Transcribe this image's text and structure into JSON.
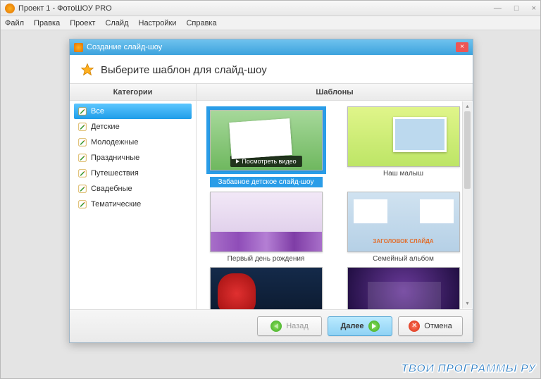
{
  "window": {
    "title": "Проект 1 - ФотоШОУ PRO",
    "controls": {
      "min": "—",
      "max": "□",
      "close": "×"
    }
  },
  "menu": [
    "Файл",
    "Правка",
    "Проект",
    "Слайд",
    "Настройки",
    "Справка"
  ],
  "dialog": {
    "title": "Создание слайд-шоу",
    "heading": "Выберите шаблон для слайд-шоу",
    "categories_header": "Категории",
    "templates_header": "Шаблоны",
    "categories": [
      {
        "label": "Все",
        "selected": true
      },
      {
        "label": "Детские",
        "selected": false
      },
      {
        "label": "Молодежные",
        "selected": false
      },
      {
        "label": "Праздничные",
        "selected": false
      },
      {
        "label": "Путешествия",
        "selected": false
      },
      {
        "label": "Свадебные",
        "selected": false
      },
      {
        "label": "Тематические",
        "selected": false
      }
    ],
    "watch_video": "Посмотреть видео",
    "templates": [
      {
        "label": "Забавное детское слайд-шоу",
        "selected": true,
        "klass": "th1"
      },
      {
        "label": "Наш малыш",
        "selected": false,
        "klass": "th2"
      },
      {
        "label": "Первый день рождения",
        "selected": false,
        "klass": "th3"
      },
      {
        "label": "Семейный альбом",
        "selected": false,
        "klass": "th4",
        "strip": "ЗАГОЛОВОК СЛАЙДА"
      },
      {
        "label": "",
        "selected": false,
        "klass": "th5"
      },
      {
        "label": "",
        "selected": false,
        "klass": "th6"
      }
    ],
    "buttons": {
      "back": "Назад",
      "next": "Далее",
      "cancel": "Отмена"
    }
  },
  "watermark": "ТВОИ ПРОГРАММЫ РУ"
}
